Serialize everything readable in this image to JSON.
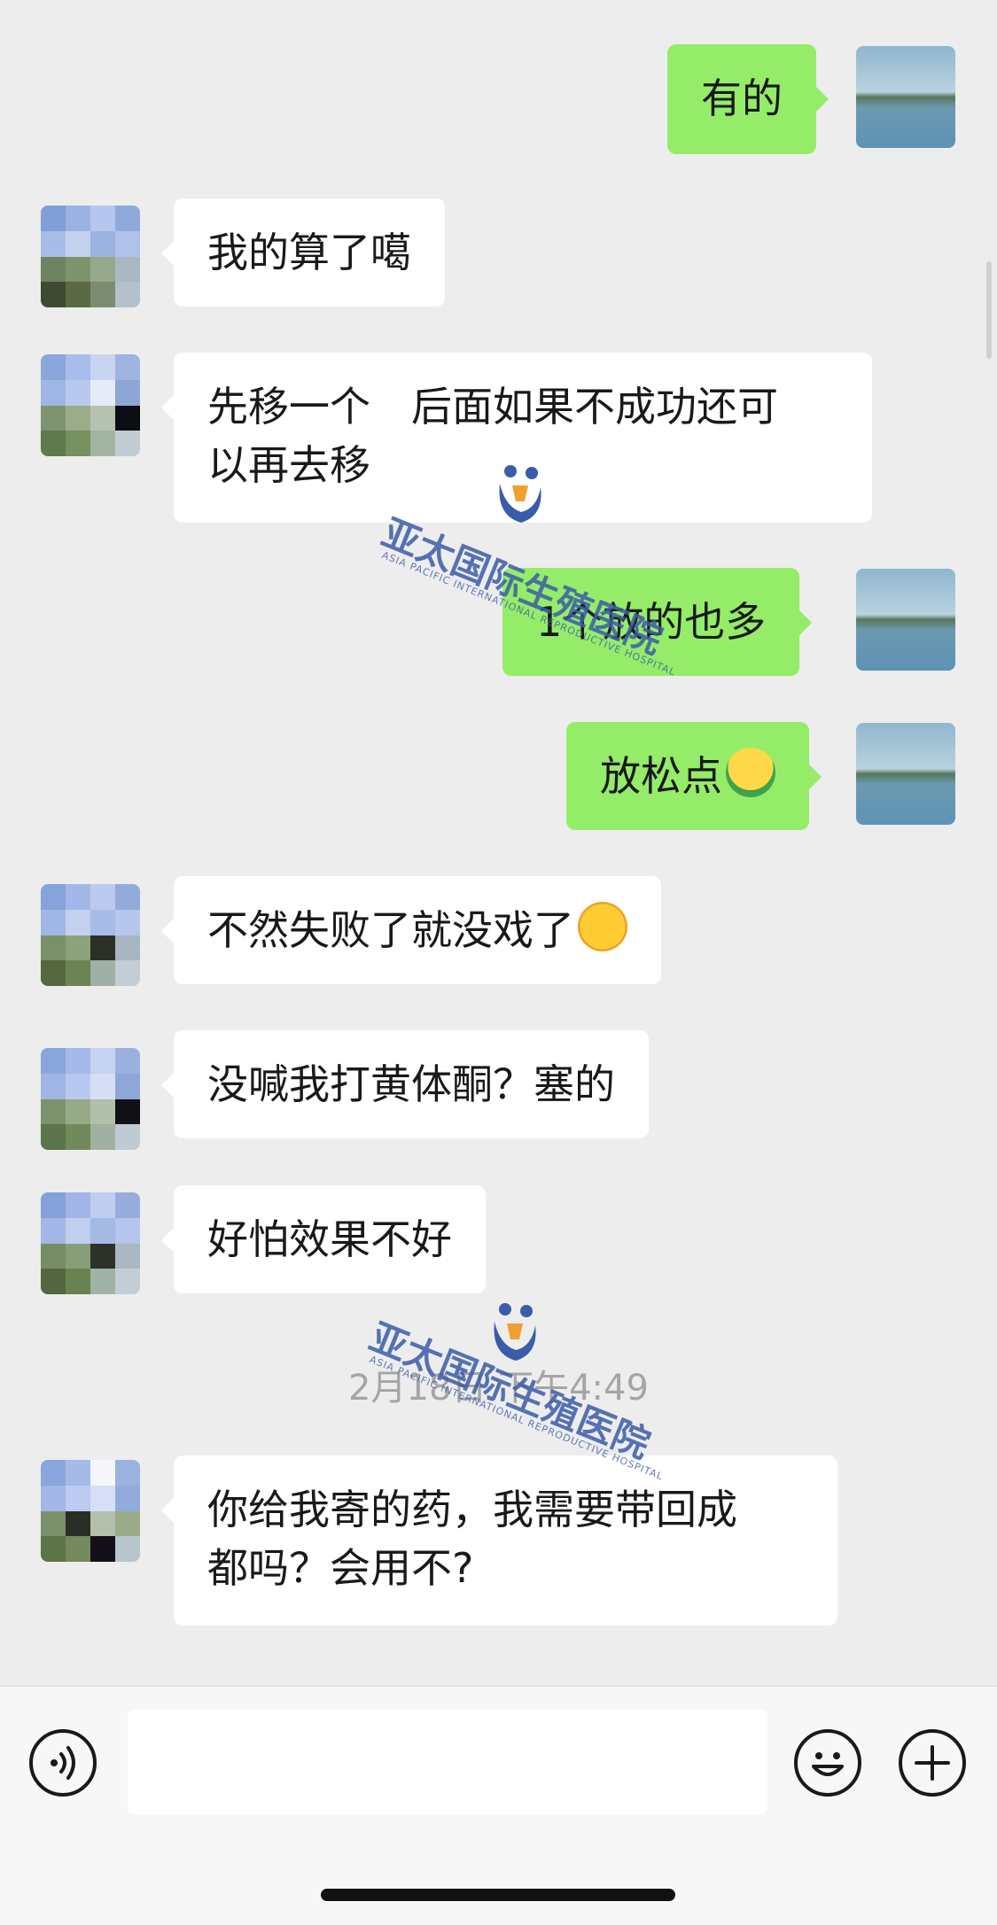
{
  "messages": [
    {
      "side": "right",
      "text": "有的"
    },
    {
      "side": "left",
      "text": "我的算了噶"
    },
    {
      "side": "left",
      "line1": "先移一个　后面如果不成功还可",
      "line2": "以再去移"
    },
    {
      "side": "right",
      "text": "1个放的也多"
    },
    {
      "side": "right",
      "text": "放松点",
      "emoji": "upside-down-face-emoji"
    },
    {
      "side": "left",
      "text": "不然失败了就没戏了",
      "emoji": "crying-face-emoji"
    },
    {
      "side": "left",
      "text": "没喊我打黄体酮？塞的"
    },
    {
      "side": "left",
      "text": "好怕效果不好"
    },
    {
      "side": "left",
      "line1": "你给我寄的药，我需要带回成",
      "line2": "都吗？会用不?"
    }
  ],
  "timestamp": "2月18日 下午4:49",
  "watermark": {
    "text": "亚太国际生殖医院",
    "subtext": "ASIA PACIFIC INTERNATIONAL REPRODUCTIVE HOSPITAL",
    "color": "#3b5ca8"
  },
  "colors": {
    "background": "#ededed",
    "sent_bubble": "#95ec69",
    "received_bubble": "#ffffff"
  },
  "input_bar": {
    "voice_icon": "voice-icon",
    "emoji_icon": "emoji-icon",
    "add_icon": "add-icon"
  }
}
